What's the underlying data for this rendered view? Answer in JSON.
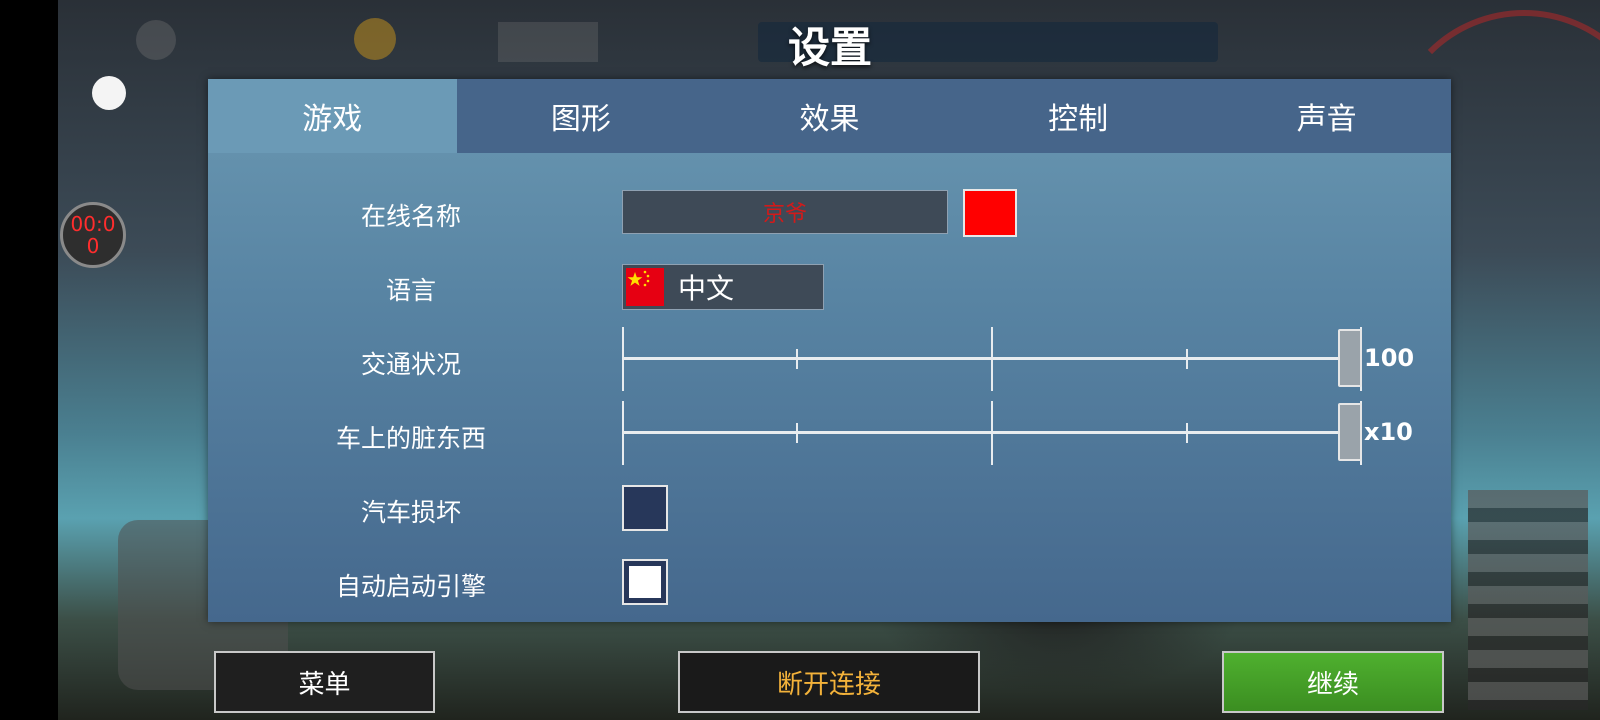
{
  "title": "设置",
  "overlay": {
    "timer_text": "00:00"
  },
  "tabs": [
    {
      "label": "游戏",
      "active": true
    },
    {
      "label": "图形",
      "active": false
    },
    {
      "label": "效果",
      "active": false
    },
    {
      "label": "控制",
      "active": false
    },
    {
      "label": "声音",
      "active": false
    }
  ],
  "settings": {
    "online_name": {
      "label": "在线名称",
      "value": "京爷",
      "text_color": "#d21a1a",
      "color_swatch": "#ff0000"
    },
    "language": {
      "label": "语言",
      "value": "中文",
      "flag_icon": "china-flag-icon"
    },
    "traffic": {
      "label": "交通状况",
      "value_text": "100",
      "level": 1.0
    },
    "car_dirt": {
      "label": "车上的脏东西",
      "value_text": "x10",
      "level": 1.0
    },
    "car_damage": {
      "label": "汽车损坏",
      "checked": false
    },
    "auto_start_engine": {
      "label": "自动启动引擎",
      "checked": true
    }
  },
  "buttons": {
    "menu": "菜单",
    "disconnect": "断开连接",
    "continue": "继续"
  },
  "colors": {
    "panel": "#5884a3",
    "tab_bar": "#46658a",
    "active_tab": "#6b9ab6",
    "continue": "#4fb02f",
    "disconnect_text": "#f3b23a"
  }
}
